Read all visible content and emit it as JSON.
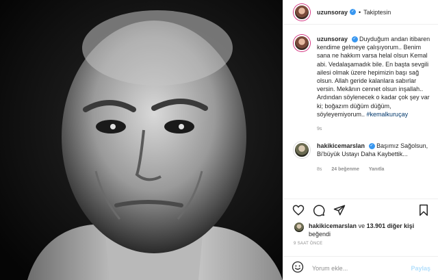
{
  "post": {
    "author": "uzunsoray",
    "follow_status": "Takiptesin",
    "separator": "•"
  },
  "caption": {
    "author": "uzunsoray",
    "text": "Duyduğum andan itibaren kendime gelmeye çalışıyorum.. Benim sana ne hakkım varsa helal olsun Kemal abi. Vedalaşamadık bile. En başta sevgili ailesi olmak üzere hepimizin başı sağ olsun. Allah geride kalanlara sabırlar versin. Mekânın cennet olsun inşallah.. Ardından söylenecek o kadar çok şey var ki; boğazım düğüm düğüm, söyleyemiyorum..",
    "hashtag": "#kemalkuruçay",
    "time": "9s"
  },
  "comment": {
    "author": "hakikicemarslan",
    "text": "Başımız Sağolsun, Bi'büyük Ustayı Daha Kaybettik...",
    "time": "8s",
    "likes": "24 beğenme",
    "reply": "Yanıtla"
  },
  "likes": {
    "user": "hakikicemarslan",
    "connector": "ve",
    "count": "13.901 diğer kişi",
    "suffix": "beğendi"
  },
  "timestamp": "9 SAAT ÖNCE",
  "add_comment": {
    "placeholder": "Yorum ekle...",
    "post_label": "Paylaş"
  },
  "icons": {
    "verified": "verified-badge-icon",
    "like": "heart-icon",
    "comment": "comment-icon",
    "share": "paper-plane-icon",
    "save": "bookmark-icon",
    "emoji": "smiley-icon"
  },
  "colors": {
    "verified": "#3897f0",
    "hashtag": "#00376b",
    "muted": "#8e8e8e",
    "post_disabled": "#b2dffc"
  }
}
